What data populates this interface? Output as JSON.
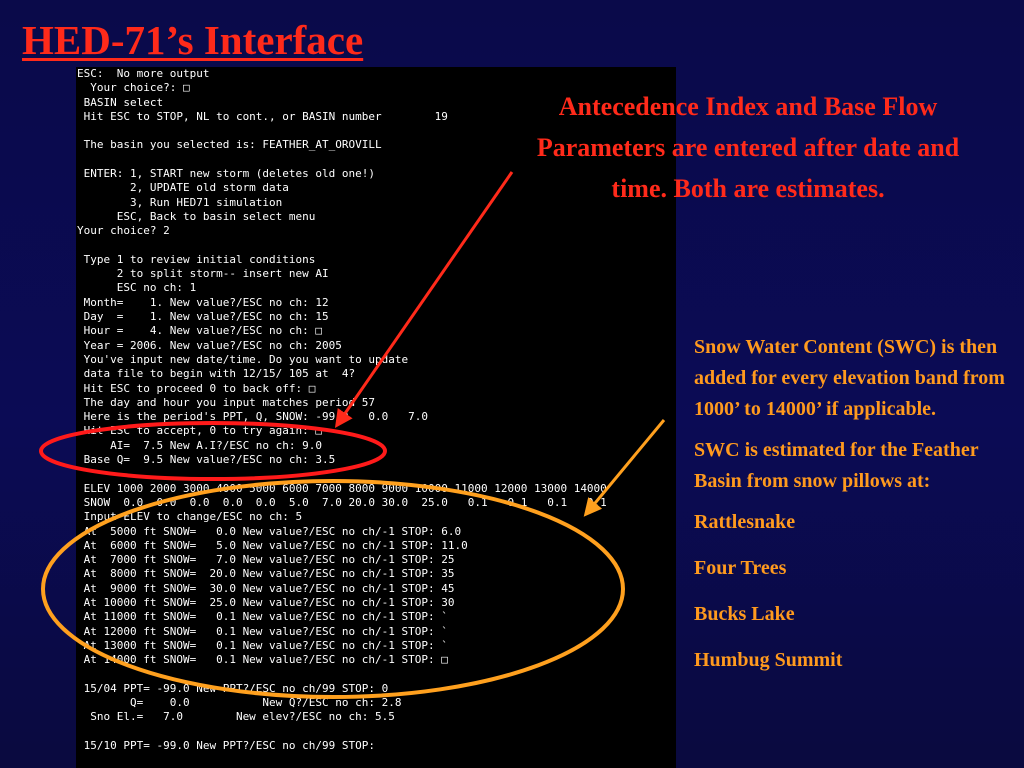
{
  "slide": {
    "title": "HED-71’s Interface"
  },
  "terminal": {
    "lines": [
      "ESC:  No more output",
      "  Your choice?: □",
      " BASIN select",
      " Hit ESC to STOP, NL to cont., or BASIN number        19",
      "",
      " The basin you selected is: FEATHER_AT_OROVILL",
      "",
      " ENTER: 1, START new storm (deletes old one!)",
      "        2, UPDATE old storm data",
      "        3, Run HED71 simulation",
      "      ESC, Back to basin select menu",
      "Your choice? 2",
      "",
      " Type 1 to review initial conditions",
      "      2 to split storm-- insert new AI",
      "      ESC no ch: 1",
      " Month=    1. New value?/ESC no ch: 12",
      " Day  =    1. New value?/ESC no ch: 15",
      " Hour =    4. New value?/ESC no ch: □",
      " Year = 2006. New value?/ESC no ch: 2005",
      " You've input new date/time. Do you want to update",
      " data file to begin with 12/15/ 105 at  4?",
      " Hit ESC to proceed 0 to back off: □",
      " The day and hour you input matches period 57",
      " Here is the period's PPT, Q, SNOW: -99.0   0.0   7.0",
      " Hit ESC to accept, 0 to try again: □",
      "     AI=  7.5 New A.I?/ESC no ch: 9.0",
      " Base Q=  9.5 New value?/ESC no ch: 3.5",
      "",
      " ELEV 1000 2000 3000 4000 5000 6000 7000 8000 9000 10000 11000 12000 13000 14000",
      " SNOW  0.0  0.0  0.0  0.0  0.0  5.0  7.0 20.0 30.0  25.0   0.1   0.1   0.1   0.1",
      " Input ELEV to change/ESC no ch: 5",
      " At  5000 ft SNOW=   0.0 New value?/ESC no ch/-1 STOP: 6.0",
      " At  6000 ft SNOW=   5.0 New value?/ESC no ch/-1 STOP: 11.0",
      " At  7000 ft SNOW=   7.0 New value?/ESC no ch/-1 STOP: 25",
      " At  8000 ft SNOW=  20.0 New value?/ESC no ch/-1 STOP: 35",
      " At  9000 ft SNOW=  30.0 New value?/ESC no ch/-1 STOP: 45",
      " At 10000 ft SNOW=  25.0 New value?/ESC no ch/-1 STOP: 30",
      " At 11000 ft SNOW=   0.1 New value?/ESC no ch/-1 STOP: `",
      " At 12000 ft SNOW=   0.1 New value?/ESC no ch/-1 STOP: `",
      " At 13000 ft SNOW=   0.1 New value?/ESC no ch/-1 STOP: `",
      " At 14000 ft SNOW=   0.1 New value?/ESC no ch/-1 STOP: □",
      "",
      " 15/04 PPT= -99.0 New PPT?/ESC no ch/99 STOP: 0",
      "        Q=    0.0           New Q?/ESC no ch: 2.8",
      "  Sno El.=   7.0        New elev?/ESC no ch: 5.5",
      "",
      " 15/10 PPT= -99.0 New PPT?/ESC no ch/99 STOP:"
    ]
  },
  "annotations": {
    "top": "Antecedence Index and Base Flow Parameters are entered after date and time.  Both are estimates.",
    "swc_intro": "Snow Water Content (SWC) is then added for every elevation band from 1000’ to 14000’ if  applicable.",
    "swc_estimate": "SWC is estimated for the Feather Basin from snow pillows at:",
    "snow_pillows": [
      "Rattlesnake",
      "Four Trees",
      "Bucks Lake",
      "Humbug Summit"
    ]
  },
  "colors": {
    "background": "#0a0a4a",
    "title": "#ff2a1a",
    "red_annotation": "#ff2a1a",
    "orange_annotation": "#ff9a1e",
    "terminal_bg": "#000000",
    "terminal_text": "#ffffff"
  }
}
